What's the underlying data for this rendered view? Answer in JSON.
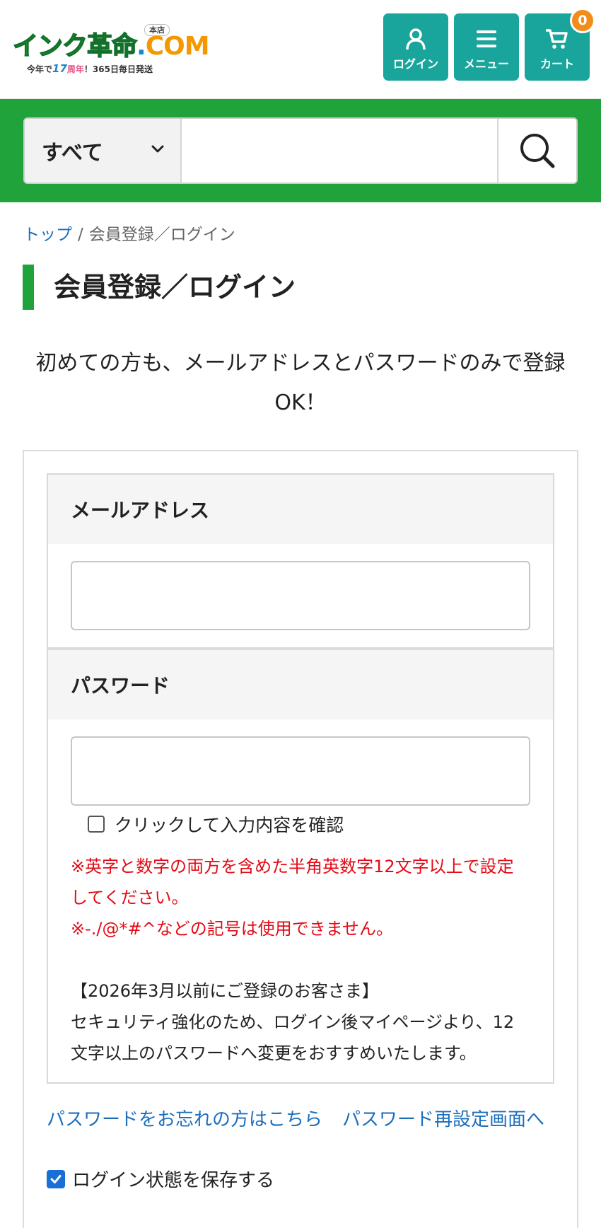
{
  "header": {
    "logo": {
      "store_tag": "本店",
      "wordmark_ink": "インク革命",
      "wordmark_dot": ".",
      "wordmark_com": "COM",
      "tagline_pre": "今年で",
      "tagline_num": "17",
      "tagline_yr": "周年",
      "tagline_post": "！365日毎日発送"
    },
    "buttons": [
      {
        "label": "ログイン",
        "icon": "person-icon"
      },
      {
        "label": "メニュー",
        "icon": "hamburger-icon"
      },
      {
        "label": "カート",
        "icon": "cart-icon"
      }
    ],
    "cart_count": "0"
  },
  "search": {
    "category": "すべて",
    "placeholder": ""
  },
  "breadcrumb": {
    "home": "トップ",
    "separator": "/",
    "current": "会員登録／ログイン"
  },
  "page_title": "会員登録／ログイン",
  "intro": "初めての方も、メールアドレスとパスワードのみで登録OK！",
  "form": {
    "email_label": "メールアドレス",
    "email_value": "",
    "password_label": "パスワード",
    "password_value": "",
    "show_password_label": "クリックして入力内容を確認",
    "note_red_1": "※英字と数字の両方を含めた半角英数字12文字以上で設定してください。",
    "note_red_2": "※-./@*#^などの記号は使用できません。",
    "note_black_1": "【2026年3月以前にご登録のお客さま】",
    "note_black_2": "セキュリティ強化のため、ログイン後マイページより、12文字以上のパスワードへ変更をおすすめいたします。"
  },
  "links": {
    "forgot_password": "パスワードをお忘れの方はこちら",
    "reset_password": "パスワード再設定画面へ"
  },
  "remember_login": {
    "label": "ログイン状態を保存する",
    "checked": true
  },
  "colors": {
    "teal": "#19a59b",
    "green": "#1fa33a",
    "badge_orange": "#f28c1a",
    "link_blue": "#1b6fbd",
    "alert_red": "#e30b17"
  }
}
